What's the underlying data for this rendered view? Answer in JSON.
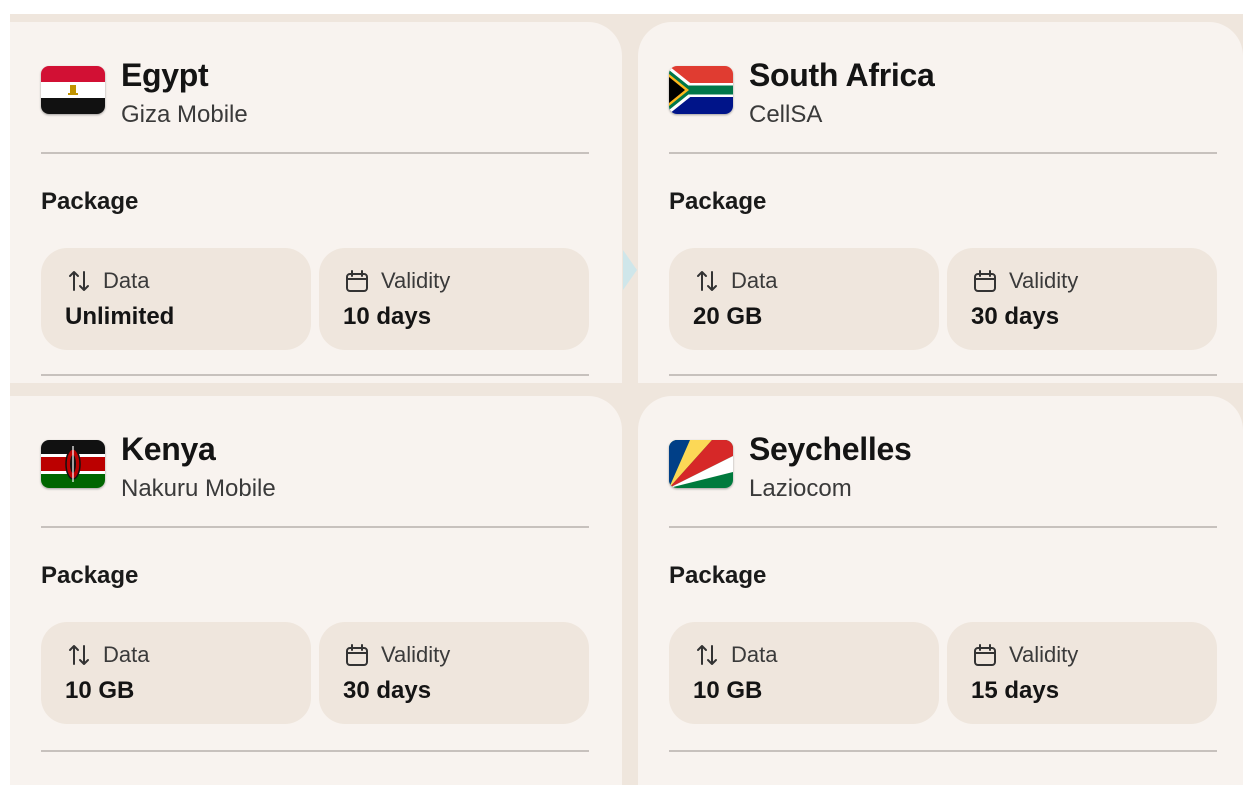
{
  "package_label": "Package",
  "data_label": "Data",
  "validity_label": "Validity",
  "cards": [
    {
      "country": "Egypt",
      "carrier": "Giza Mobile",
      "data": "Unlimited",
      "validity": "10 days",
      "flag_icon": "egypt-flag-icon"
    },
    {
      "country": "South Africa",
      "carrier": "CellSA",
      "data": "20 GB",
      "validity": "30 days",
      "flag_icon": "south-africa-flag-icon"
    },
    {
      "country": "Kenya",
      "carrier": "Nakuru Mobile",
      "data": "10 GB",
      "validity": "30 days",
      "flag_icon": "kenya-flag-icon"
    },
    {
      "country": "Seychelles",
      "carrier": "Laziocom",
      "data": "10 GB",
      "validity": "15 days",
      "flag_icon": "seychelles-flag-icon"
    }
  ],
  "colors": {
    "card_background": "#f8f3ef",
    "tile_background": "#efe6dd",
    "divider": "#c7c1bd",
    "text_primary": "#141414"
  }
}
